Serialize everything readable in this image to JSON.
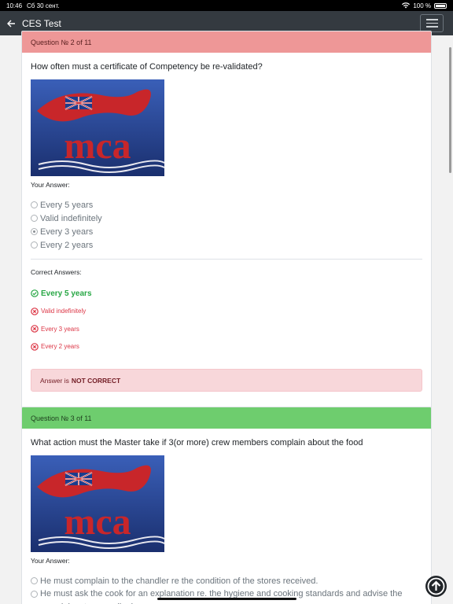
{
  "status_bar": {
    "time": "10:46",
    "date": "Сб 30 сент.",
    "battery": "100 %"
  },
  "nav": {
    "title": "CES Test"
  },
  "questions": [
    {
      "header": "Question № 2 of 11",
      "text": "How often must a certificate of Competency be re-validated?",
      "logo_text": "mca",
      "your_answer_label": "Your Answer:",
      "options": [
        "Every 5 years",
        "Valid indefinitely",
        "Every 3 years",
        "Every 2 years"
      ],
      "selected_index": 2,
      "correct_label": "Correct Answers:",
      "answers": [
        {
          "text": "Every 5 years",
          "correct": true
        },
        {
          "text": "Valid indefinitely",
          "correct": false
        },
        {
          "text": "Every 3 years",
          "correct": false
        },
        {
          "text": "Every 2 years",
          "correct": false
        }
      ],
      "result_prefix": "Answer is",
      "result_status": "NOT CORRECT"
    },
    {
      "header": "Question № 3 of 11",
      "text": "What action must the Master take if 3(or more) crew members complain about the food",
      "logo_text": "mca",
      "your_answer_label": "Your Answer:",
      "options": [
        "He must complain to the chandler re the condition of the stores received.",
        "He must ask the cook for an explanation re. the hygiene and cooking standards and advise the complainants accordingly"
      ]
    }
  ],
  "colors": {
    "navbar": "#343a40",
    "wrong_header": "#ee9797",
    "right_header": "#6ecd6e",
    "correct_text": "#28a745",
    "incorrect_text": "#dc3545"
  },
  "icons": {
    "back": "arrow-left-icon",
    "menu": "hamburger-icon",
    "scroll_top": "arrow-up-circle-icon"
  }
}
